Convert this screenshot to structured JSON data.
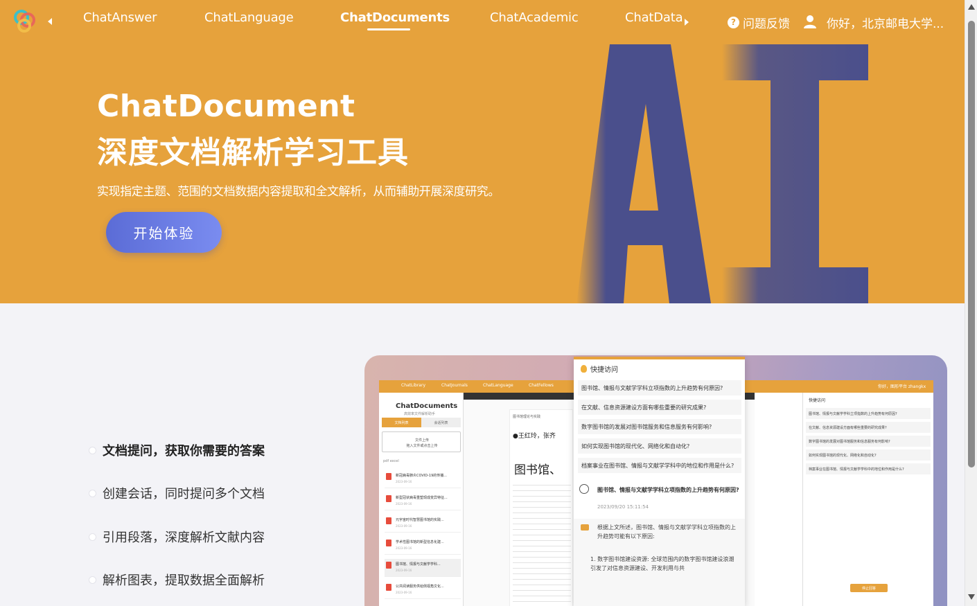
{
  "nav": {
    "items": [
      {
        "label": "ChatAnswer",
        "active": false
      },
      {
        "label": "ChatLanguage",
        "active": false
      },
      {
        "label": "ChatDocuments",
        "active": true
      },
      {
        "label": "ChatAcademic",
        "active": false
      },
      {
        "label": "ChatData",
        "active": false
      }
    ],
    "feedback": "问题反馈",
    "user_greeting": "你好，北京邮电大学..."
  },
  "hero": {
    "title": "ChatDocument",
    "subtitle": "深度文档解析学习工具",
    "description": "实现指定主题、范围的文档数据内容提取和全文解析，从而辅助开展深度研究。",
    "cta": "开始体验",
    "art_text": "AI"
  },
  "features": [
    {
      "label": "文档提问，获取你需要的答案",
      "active": true
    },
    {
      "label": "创建会话，同时提问多个文档",
      "active": false
    },
    {
      "label": "引用段落，深度解析文献内容",
      "active": false
    },
    {
      "label": "解析图表，提取数据全面解析",
      "active": false
    }
  ],
  "mockup": {
    "nav": [
      "ChatLibrary",
      "ChatJournals",
      "ChatLanguage",
      "ChatFellows"
    ],
    "user": "你好，图形平台 zhangkx",
    "sidebar_title": "ChatDocuments",
    "sidebar_sub": "高效率文件解析助手",
    "tabs": [
      "文档列表",
      "会话列表"
    ],
    "upload": [
      "文件上传",
      "拖入文件或点击上传"
    ],
    "filters": "pdf     excel",
    "files": [
      {
        "name": "新冠病毒肺炎COVID-19的传播...",
        "date": "2023-09-16"
      },
      {
        "name": "新型冠状病毒重塑现成变异特征...",
        "date": "2023-09-16"
      },
      {
        "name": "元宇宙时代智慧图书馆的实践...",
        "date": "2023-09-16"
      },
      {
        "name": "学术性图书馆的新型信息化建...",
        "date": "2023-09-16"
      },
      {
        "name": "图书馆、情报与文献学学科...",
        "date": "2023-09-16"
      },
      {
        "name": "公共阅读服务供给侧视角文化...",
        "date": "2023-09-16"
      }
    ],
    "page_header": "图书馆理论与实践",
    "page_author": "●王红玲，张齐",
    "page_heading": "图书馆、",
    "right_title": "快捷访问",
    "right_questions": [
      "图书馆、情报与文献学学科立项指数的上升趋势有何原因?",
      "在文献、信息资源建设方面有哪些重要的研究成果?",
      "数字图书馆的发展对图书馆服务和信息服务有何影响?",
      "如何实现图书馆的现代化、网络化和自动化?",
      "档案事业在图书馆、情报与文献学学科中的地位和作用是什么?"
    ],
    "right_stop": "停止回答",
    "popup": {
      "title": "快捷访问",
      "questions": [
        "图书馆、情报与文献学学科立项指数的上升趋势有何原因?",
        "在文献、信息资源建设方面有哪些重要的研究成果?",
        "数字图书馆的发展对图书馆服务和信息服务有何影响?",
        "如何实现图书馆的现代化、网络化和自动化?",
        "档案事业在图书馆、情报与文献学学科中的地位和作用是什么?"
      ],
      "user_question": "图书馆、情报与文献学学科立项指数的上升趋势有何原因?",
      "time": "2023/09/20 15:11:54",
      "answer_intro": "根据上文所述，图书馆、情报与文献学学科立项指数的上升趋势可能有以下原因:",
      "answer_point": "1. 数字图书馆建设资源: 全球范围内的数字图书馆建设浪潮引发了对信息资源建设、开发利用与共"
    }
  },
  "colors": {
    "primary": "#e6a23c",
    "cta": "#5b6cd6",
    "art": "#4a4f8c"
  }
}
